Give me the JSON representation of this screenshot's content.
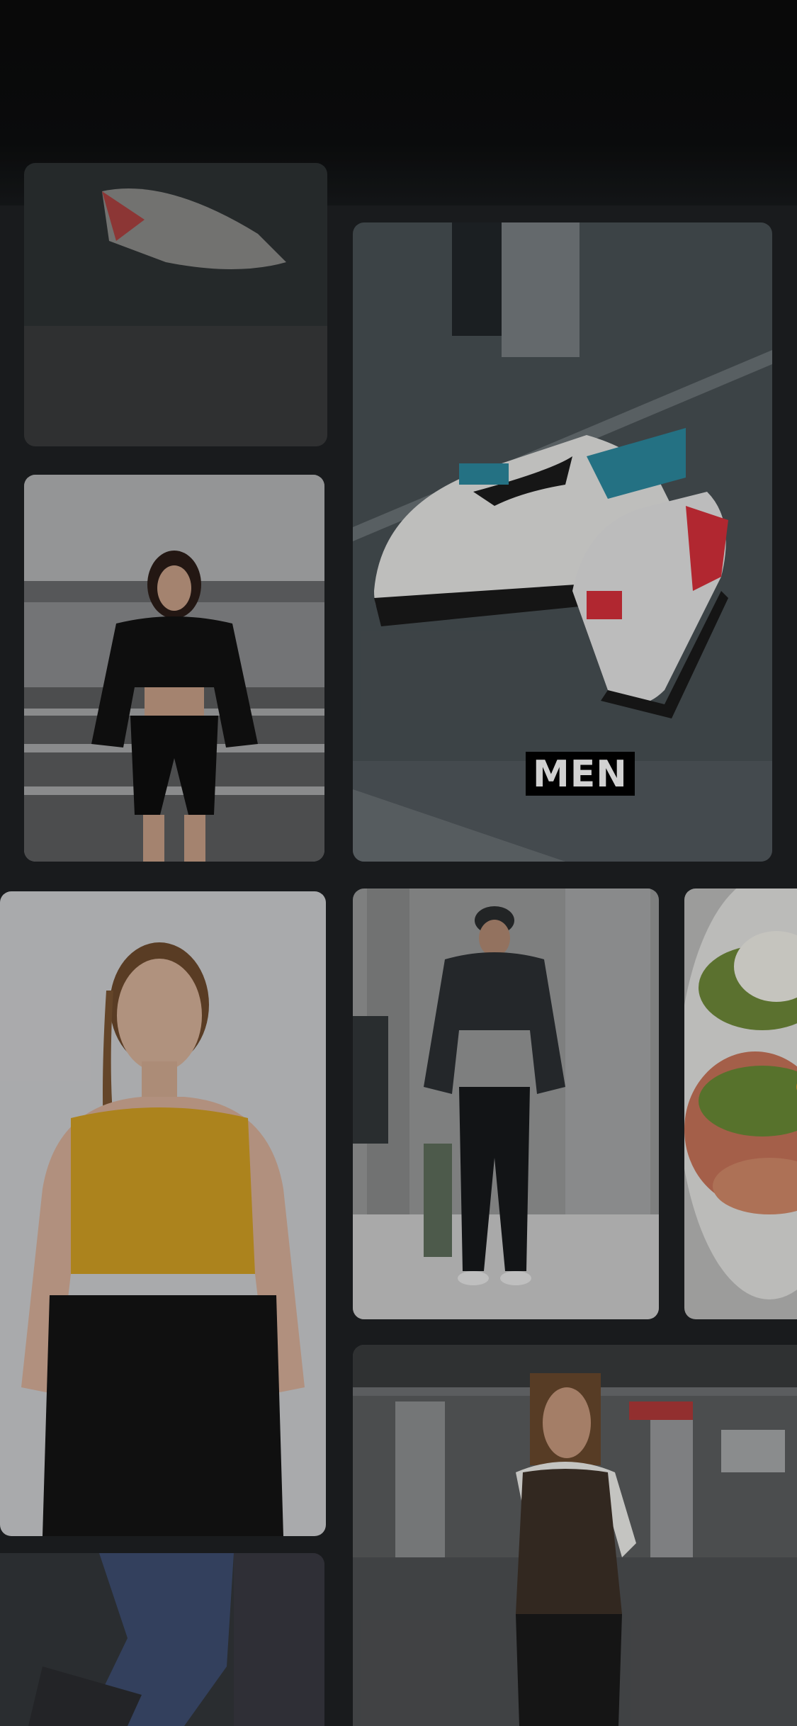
{
  "feed": {
    "tiles": [
      {
        "name": "sneaker-detail-tile"
      },
      {
        "name": "women-outfit-tile"
      },
      {
        "name": "men-sneakers-tile",
        "badge": "MEN"
      },
      {
        "name": "yellow-crop-top-tile"
      },
      {
        "name": "men-tracksuit-tile"
      },
      {
        "name": "food-tile"
      },
      {
        "name": "parking-garage-woman-tile"
      },
      {
        "name": "jeans-tile"
      }
    ]
  },
  "colors": {
    "background": "#1f2224",
    "badge_background": "#000000",
    "badge_text": "#ffffff"
  }
}
